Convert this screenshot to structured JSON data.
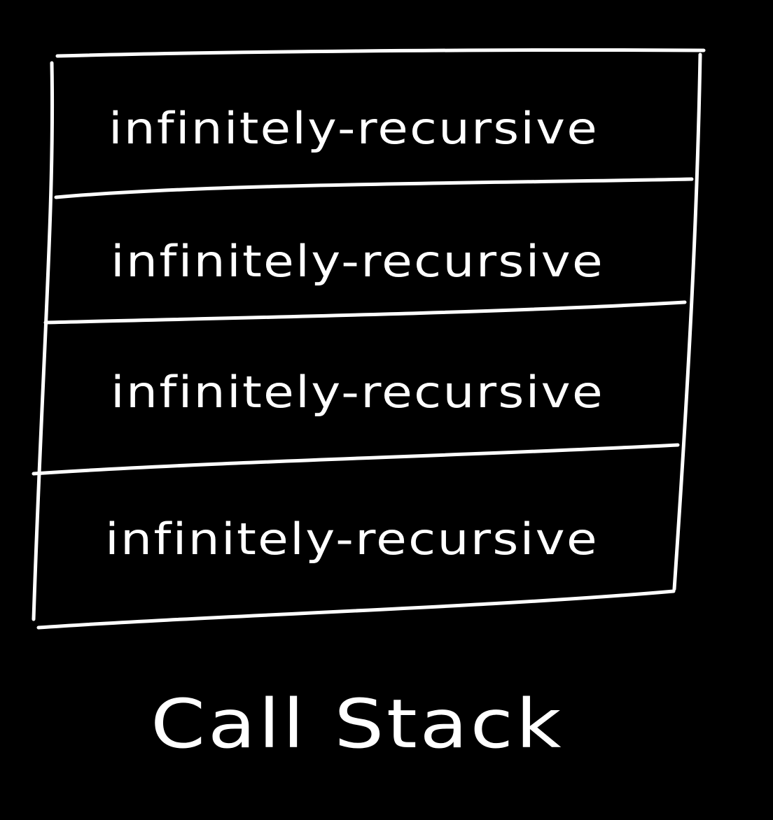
{
  "diagram": {
    "caption": "Call Stack",
    "frames": [
      {
        "label": "infinitely-recursive"
      },
      {
        "label": "infinitely-recursive"
      },
      {
        "label": "infinitely-recursive"
      },
      {
        "label": "infinitely-recursive"
      }
    ]
  },
  "colors": {
    "background": "#000000",
    "ink": "#ffffff"
  }
}
